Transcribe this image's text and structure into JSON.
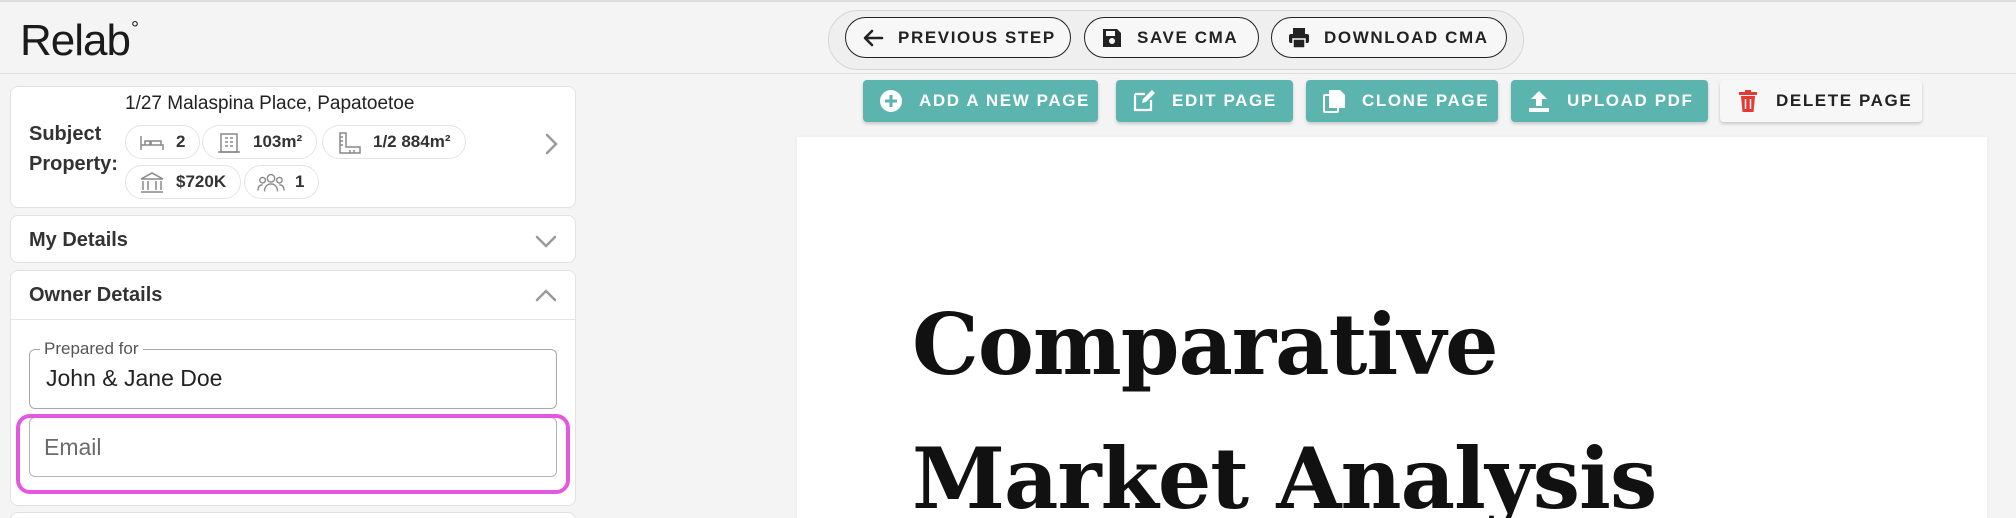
{
  "app": {
    "logo": "Relab",
    "logo_mark": "°"
  },
  "header": {
    "previous_step": "PREVIOUS STEP",
    "save_cma": "SAVE CMA",
    "download_cma": "DOWNLOAD CMA"
  },
  "subject": {
    "label_line1": "Subject",
    "label_line2": "Property:",
    "address": "1/27 Malaspina Place, Papatoetoe",
    "chips": {
      "bedrooms": "2",
      "floor_area": "103m²",
      "land_area": "1/2 884m²",
      "value": "$720K",
      "owners": "1"
    }
  },
  "sections": {
    "my_details": "My Details",
    "owner_details": "Owner Details"
  },
  "owner": {
    "prepared_for_label": "Prepared for",
    "prepared_for_value": "John & Jane Doe",
    "email_placeholder": "Email",
    "email_value": ""
  },
  "toolbar": {
    "add_page": "ADD A NEW PAGE",
    "edit_page": "EDIT PAGE",
    "clone_page": "CLONE PAGE",
    "upload_pdf": "UPLOAD PDF",
    "delete_page": "DELETE PAGE"
  },
  "document": {
    "title_line1": "Comparative",
    "title_line2": "Market Analysis"
  },
  "colors": {
    "accent": "#5cb4ae",
    "delete_icon": "#e53935",
    "focus_highlight": "#e458e0"
  },
  "icons": {
    "previous_step": "arrow-left-icon",
    "save_cma": "floppy-disk-icon",
    "download_cma": "printer-icon",
    "bedrooms": "bed-icon",
    "floor_area": "building-icon",
    "land_area": "ruler-icon",
    "value": "bank-icon",
    "owners": "people-icon",
    "add_page": "plus-circle-icon",
    "edit_page": "edit-icon",
    "clone_page": "copy-icon",
    "upload_pdf": "upload-icon",
    "delete_page": "trash-icon"
  }
}
